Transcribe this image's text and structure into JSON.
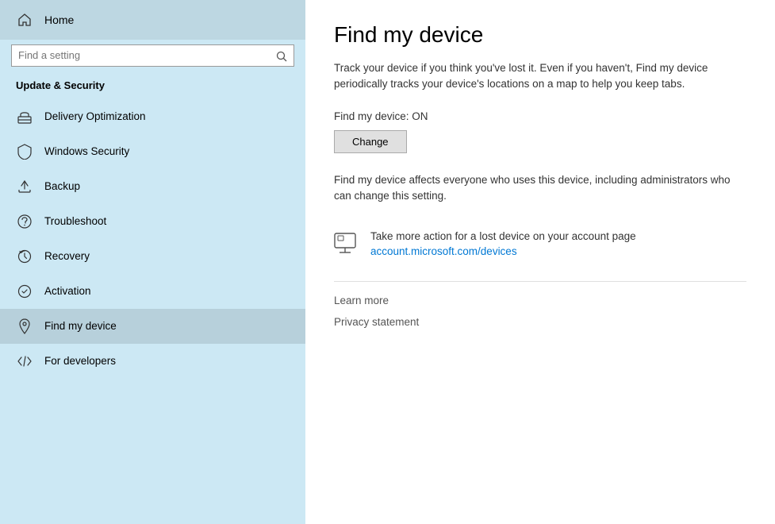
{
  "sidebar": {
    "home_label": "Home",
    "search_placeholder": "Find a setting",
    "section_title": "Update & Security",
    "items": [
      {
        "id": "delivery-optimization",
        "label": "Delivery Optimization",
        "icon": "delivery"
      },
      {
        "id": "windows-security",
        "label": "Windows Security",
        "icon": "shield"
      },
      {
        "id": "backup",
        "label": "Backup",
        "icon": "backup"
      },
      {
        "id": "troubleshoot",
        "label": "Troubleshoot",
        "icon": "troubleshoot"
      },
      {
        "id": "recovery",
        "label": "Recovery",
        "icon": "recovery"
      },
      {
        "id": "activation",
        "label": "Activation",
        "icon": "activation"
      },
      {
        "id": "find-my-device",
        "label": "Find my device",
        "icon": "find-device",
        "active": true
      },
      {
        "id": "for-developers",
        "label": "For developers",
        "icon": "developers"
      }
    ]
  },
  "main": {
    "page_title": "Find my device",
    "description": "Track your device if you think you've lost it. Even if you haven't, Find my device periodically tracks your device's locations on a map to help you keep tabs.",
    "status_label": "Find my device: ON",
    "change_button": "Change",
    "affect_text": "Find my device affects everyone who uses this device, including administrators who can change this setting.",
    "action_heading": "Take more action for a lost device on your account page",
    "action_link_text": "account.microsoft.com/devices",
    "learn_more_label": "Learn more",
    "privacy_statement_label": "Privacy statement"
  }
}
